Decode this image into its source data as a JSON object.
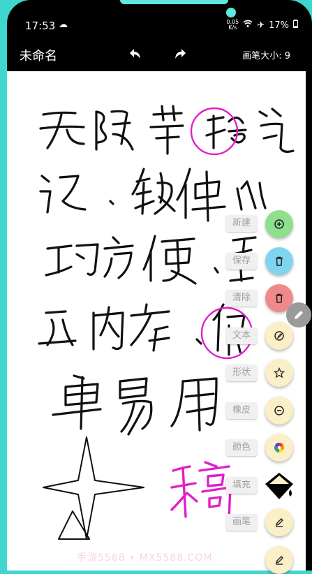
{
  "status_bar": {
    "time": "17:53",
    "speed_value": "0.05",
    "speed_unit": "K/s",
    "battery": "17%"
  },
  "app_bar": {
    "title": "未命名",
    "brush_size_label": "画笔大小: 9"
  },
  "canvas": {
    "watermark": "手游5588 • MX5588.COM"
  },
  "menu": [
    {
      "id": "new",
      "label": "新建",
      "color": "#8ee08f",
      "icon": "plus-circle-icon"
    },
    {
      "id": "save",
      "label": "保存",
      "color": "#7fd4ef",
      "icon": "trash-icon"
    },
    {
      "id": "clear",
      "label": "清除",
      "color": "#ef8a8a",
      "icon": "trash-icon"
    },
    {
      "id": "text",
      "label": "文本",
      "color": "#fbefc8",
      "icon": "edit-circle-icon"
    },
    {
      "id": "shape",
      "label": "形状",
      "color": "#fbefc8",
      "icon": "star-icon"
    },
    {
      "id": "eraser",
      "label": "橡皮",
      "color": "#fbefc8",
      "icon": "minus-circle-icon"
    },
    {
      "id": "color",
      "label": "颜色",
      "color": "#fbefc8",
      "icon": "palette-icon"
    },
    {
      "id": "fill",
      "label": "填充",
      "color": "#fbefc8",
      "icon": "paint-bucket-icon"
    },
    {
      "id": "pen",
      "label": "画笔",
      "color": "#fbefc8",
      "icon": "pen-icon"
    }
  ]
}
